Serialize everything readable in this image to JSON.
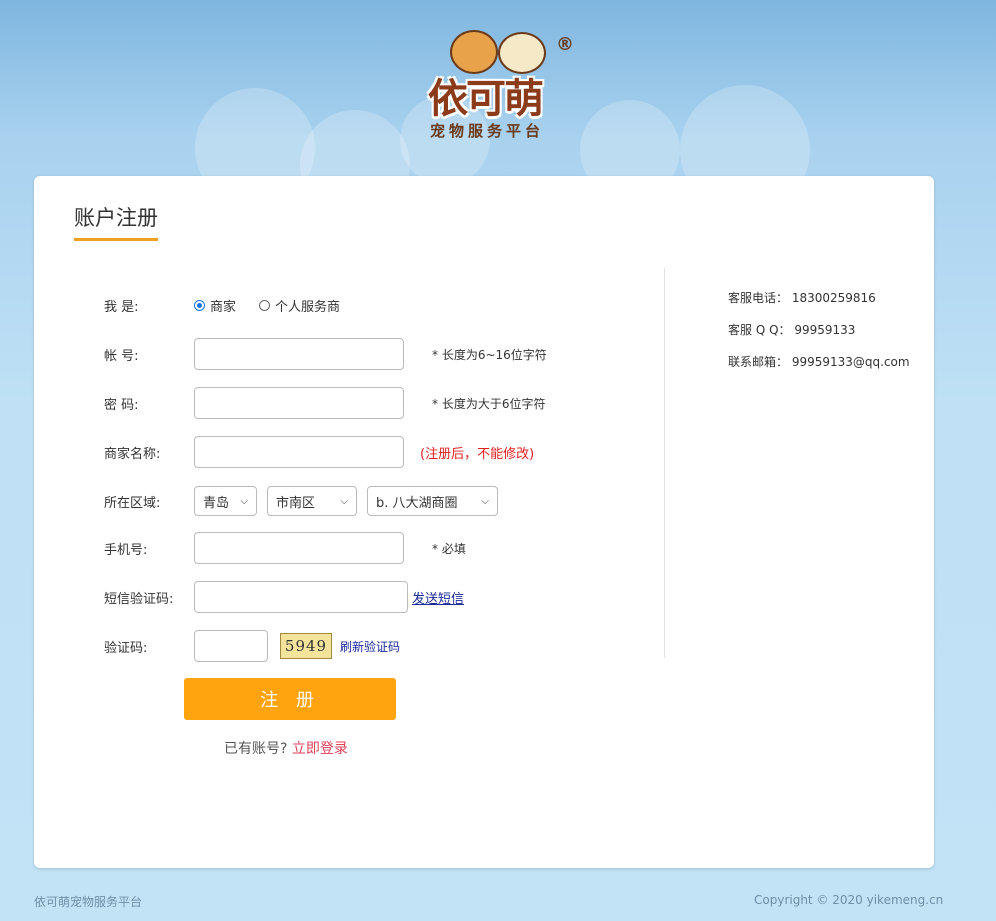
{
  "brand": {
    "logo_text": "依可萌",
    "slogan": "宠物服务平台",
    "reg_mark": "®"
  },
  "page_title": "账户注册",
  "form": {
    "role": {
      "label": "我 是:",
      "options": [
        "商家",
        "个人服务商"
      ],
      "selected": "商家"
    },
    "account": {
      "label": "帐 号:",
      "value": "",
      "hint": "* 长度为6~16位字符"
    },
    "password": {
      "label": "密 码:",
      "value": "",
      "hint": "* 长度为大于6位字符"
    },
    "merchant_name": {
      "label": "商家名称:",
      "value": "",
      "hint": "(注册后，不能修改)"
    },
    "region": {
      "label": "所在区域:",
      "city": "青岛",
      "district": "市南区",
      "zone": "b. 八大湖商圈"
    },
    "phone": {
      "label": "手机号:",
      "value": "",
      "hint": "* 必填"
    },
    "sms_code": {
      "label": "短信验证码:",
      "value": "",
      "send_link": "发送短信"
    },
    "captcha": {
      "label": "验证码:",
      "value": "",
      "image_text": "5949",
      "refresh": "刷新验证码"
    },
    "submit": "注 册",
    "login_prompt": "已有账号?",
    "login_link": "立即登录"
  },
  "contact": {
    "phone": "客服电话： 18300259816",
    "qq": "客服 Q Q： 99959133",
    "email": "联系邮箱： 99959133@qq.com"
  },
  "footer": {
    "left": "依可萌宠物服务平台",
    "right": "Copyright © 2020 yikemeng.cn"
  },
  "colors": {
    "accent": "#ffa30f",
    "title_underline": "#f0a020",
    "warning": "#e02020",
    "link": "#1a2a9a",
    "login_link": "#e0405a"
  }
}
